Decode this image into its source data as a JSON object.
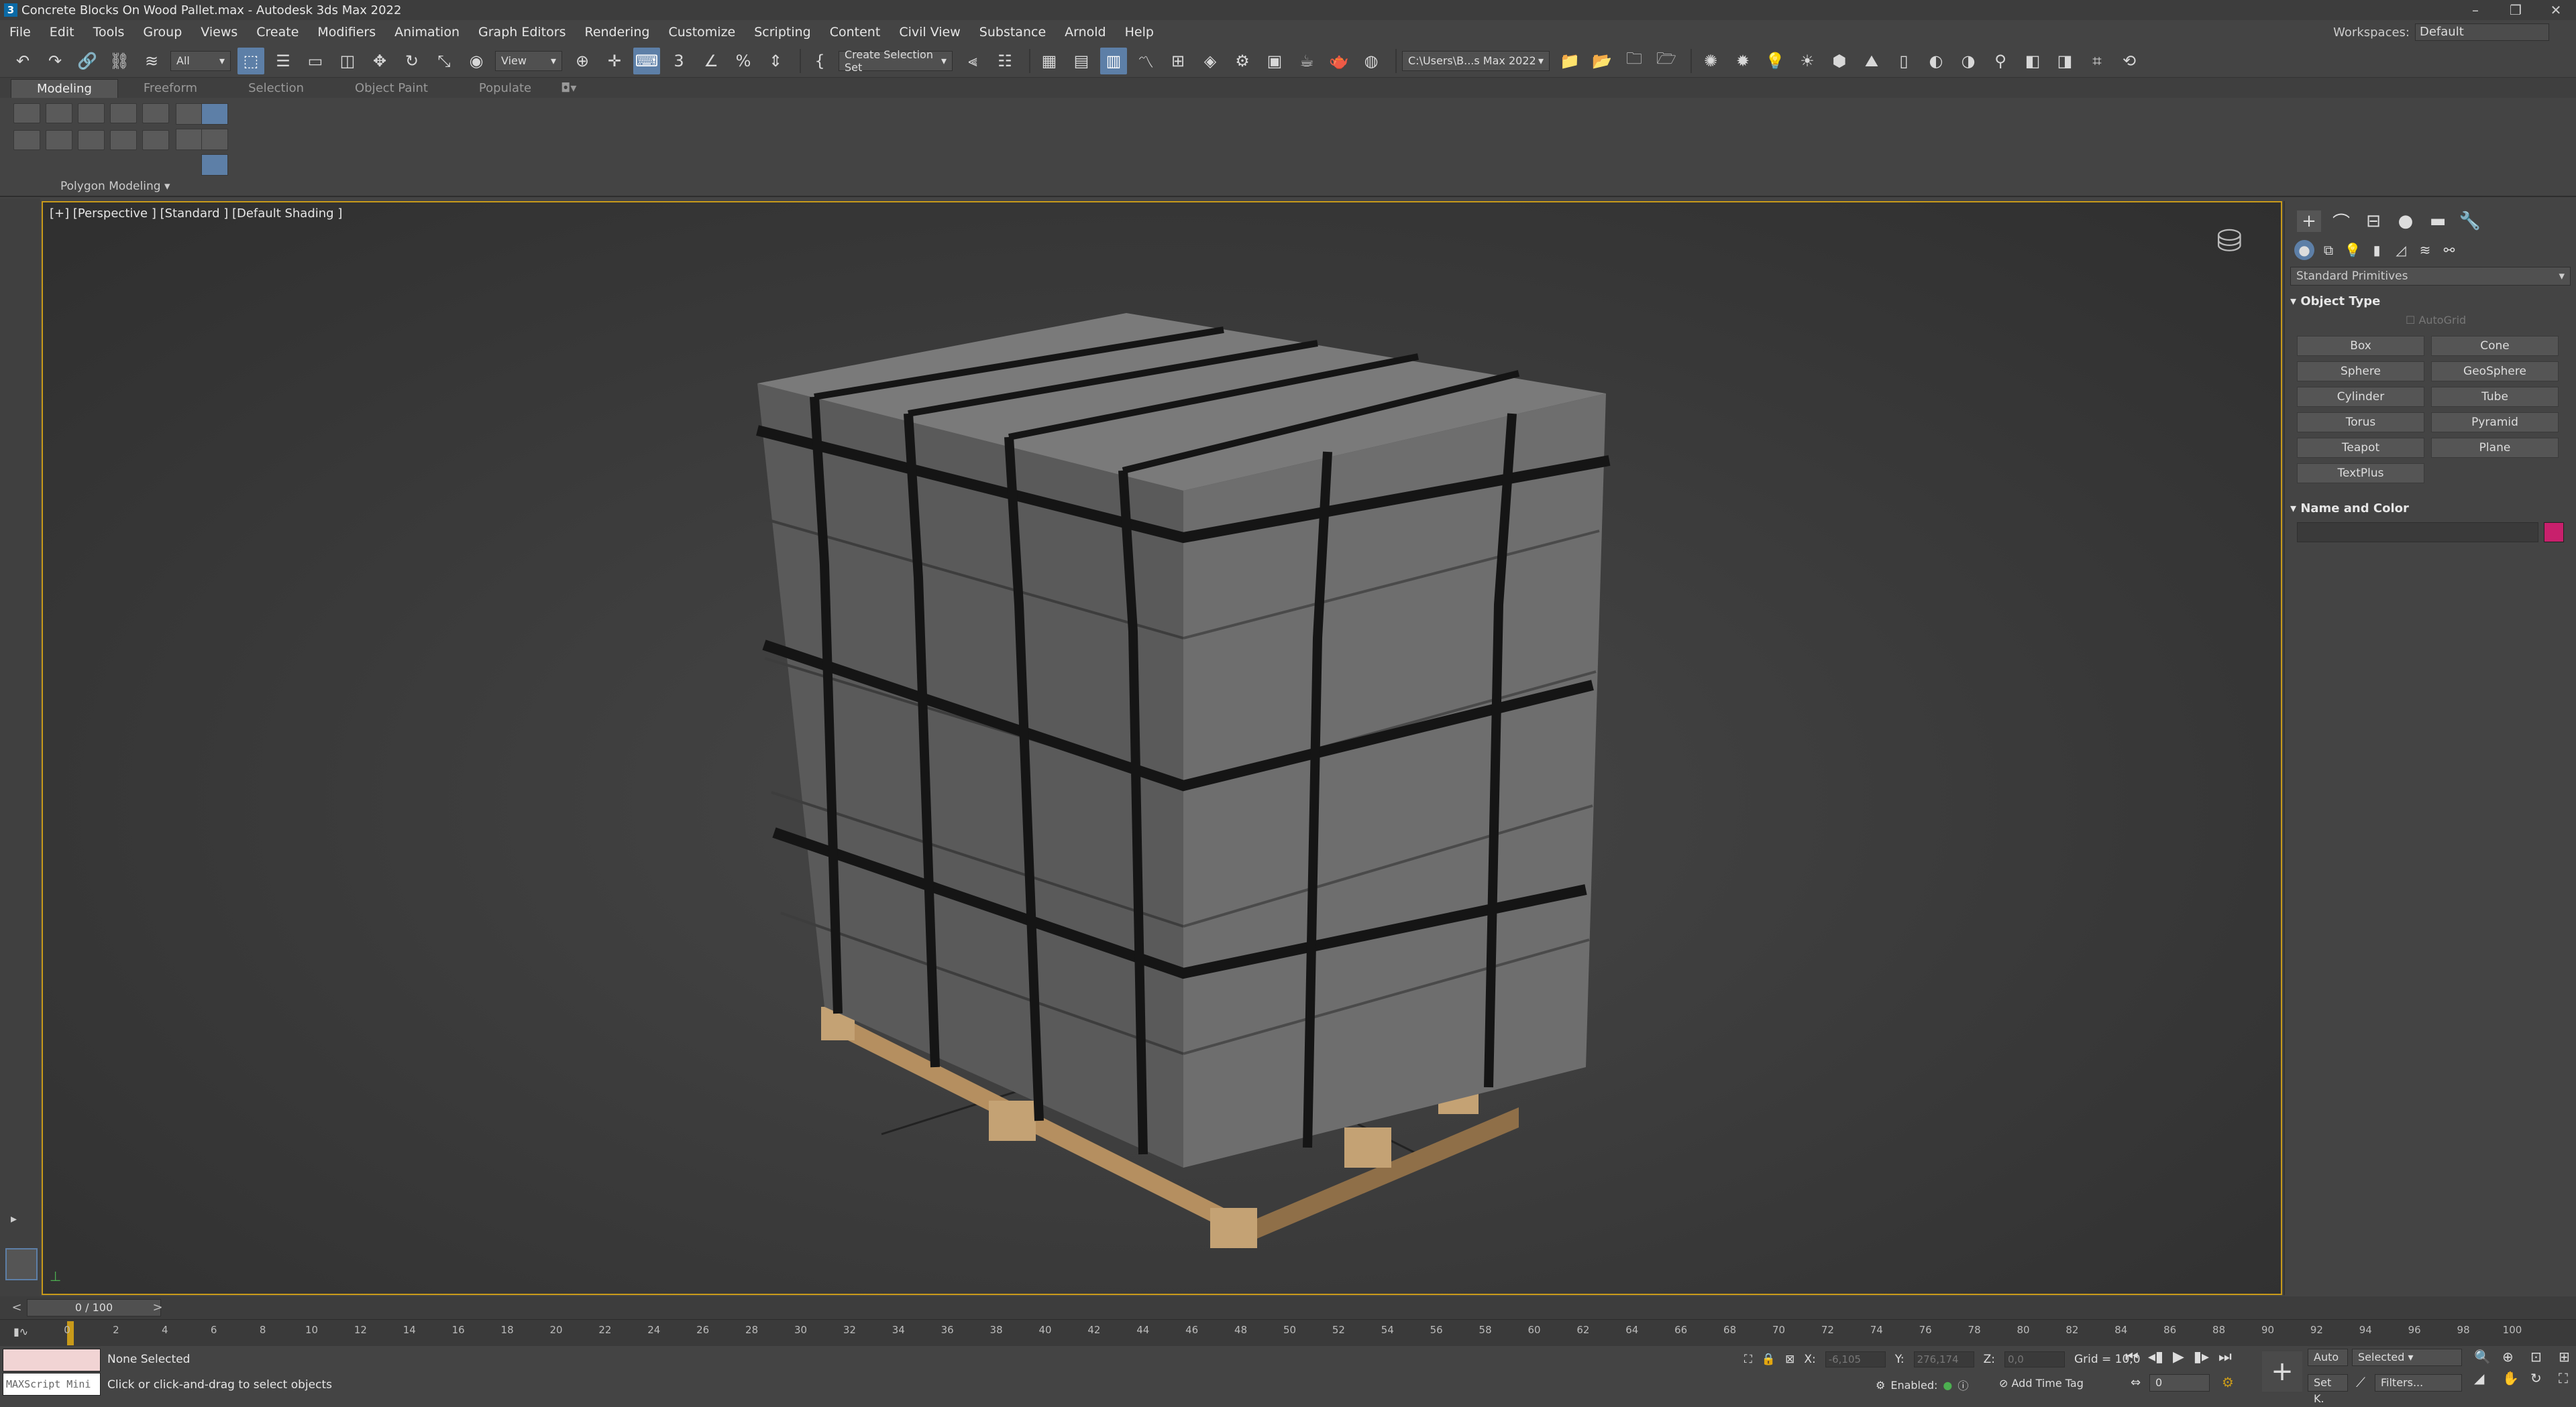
{
  "window": {
    "title": "Concrete Blocks On Wood Pallet.max - Autodesk 3ds Max 2022",
    "app_icon": "3"
  },
  "menu": [
    "File",
    "Edit",
    "Tools",
    "Group",
    "Views",
    "Create",
    "Modifiers",
    "Animation",
    "Graph Editors",
    "Rendering",
    "Customize",
    "Scripting",
    "Content",
    "Civil View",
    "Substance",
    "Arnold",
    "Help"
  ],
  "workspace": {
    "label": "Workspaces:",
    "value": "Default"
  },
  "toolbar": {
    "filter": "All",
    "view": "View",
    "selection_set": "Create Selection Set",
    "path": "C:\\Users\\B...s Max 2022"
  },
  "ribbon": {
    "tabs": [
      "Modeling",
      "Freeform",
      "Selection",
      "Object Paint",
      "Populate"
    ],
    "panel": "Polygon Modeling"
  },
  "viewport": {
    "label": "[+] [Perspective ] [Standard ] [Default Shading ]"
  },
  "command_panel": {
    "category": "Standard Primitives",
    "object_type_title": "Object Type",
    "autogrid": "AutoGrid",
    "buttons": [
      "Box",
      "Cone",
      "Sphere",
      "GeoSphere",
      "Cylinder",
      "Tube",
      "Torus",
      "Pyramid",
      "Teapot",
      "Plane",
      "TextPlus"
    ],
    "name_color_title": "Name and Color",
    "object_color": "#c8206c"
  },
  "timeline": {
    "frame": "0 / 100",
    "ticks": [
      "0",
      "2",
      "4",
      "6",
      "8",
      "10",
      "12",
      "14",
      "16",
      "18",
      "20",
      "22",
      "24",
      "26",
      "28",
      "30",
      "32",
      "34",
      "36",
      "38",
      "40",
      "42",
      "44",
      "46",
      "48",
      "50",
      "52",
      "54",
      "56",
      "58",
      "60",
      "62",
      "64",
      "66",
      "68",
      "70",
      "72",
      "74",
      "76",
      "78",
      "80",
      "82",
      "84",
      "86",
      "88",
      "90",
      "92",
      "94",
      "96",
      "98",
      "100"
    ]
  },
  "status": {
    "maxscript": "MAXScript Mini",
    "selection": "None Selected",
    "prompt": "Click or click-and-drag to select objects",
    "x_label": "X:",
    "x": "-6,105",
    "y_label": "Y:",
    "y": "276,174",
    "z_label": "Z:",
    "z": "0,0",
    "grid": "Grid = 10,0",
    "enabled": "Enabled:",
    "add_time_tag": "Add Time Tag",
    "auto": "Auto",
    "selected": "Selected",
    "set_key": "Set K.",
    "filters": "Filters...",
    "frame_field": "0"
  }
}
